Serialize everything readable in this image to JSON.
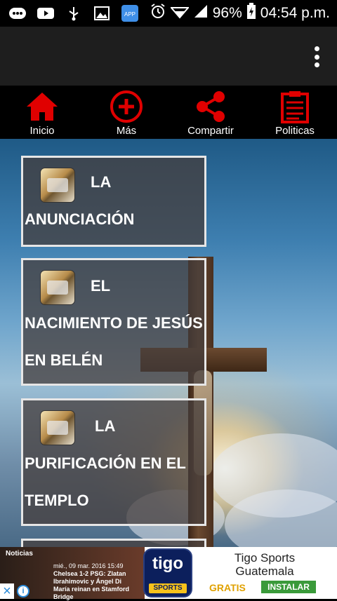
{
  "status_bar": {
    "battery": "96%",
    "time": "04:54 p.m."
  },
  "nav": {
    "items": [
      {
        "label": "Inicio",
        "icon": "home-icon"
      },
      {
        "label": "Más",
        "icon": "plus-circle-icon"
      },
      {
        "label": "Compartir",
        "icon": "share-icon"
      },
      {
        "label": "Politicas",
        "icon": "clipboard-icon"
      }
    ]
  },
  "cards": [
    {
      "first_word": "LA",
      "rest": "ANUNCIACIÓN"
    },
    {
      "first_word": "EL",
      "rest1": "NACIMIENTO DE JESÚS",
      "rest2": "EN BELÉN"
    },
    {
      "first_word": "LA",
      "rest1": "PURIFICACIÓN EN EL",
      "rest2": "TEMPLO"
    }
  ],
  "ad": {
    "noticias": "Noticias",
    "news_line1": "mié., 09 mar. 2016 15:49",
    "news_line2": "Chelsea 1-2 PSG: Zlatan Ibrahimovic y Ángel Di",
    "news_line3": "María reinan en Stamford Bridge",
    "logo_text": "tigo",
    "logo_sub": "SPORTS",
    "title": "Tigo Sports Guatemala",
    "free": "GRATIS",
    "install": "INSTALAR"
  },
  "colors": {
    "accent_red": "#e00000",
    "app_bar": "#1e1e1e"
  }
}
